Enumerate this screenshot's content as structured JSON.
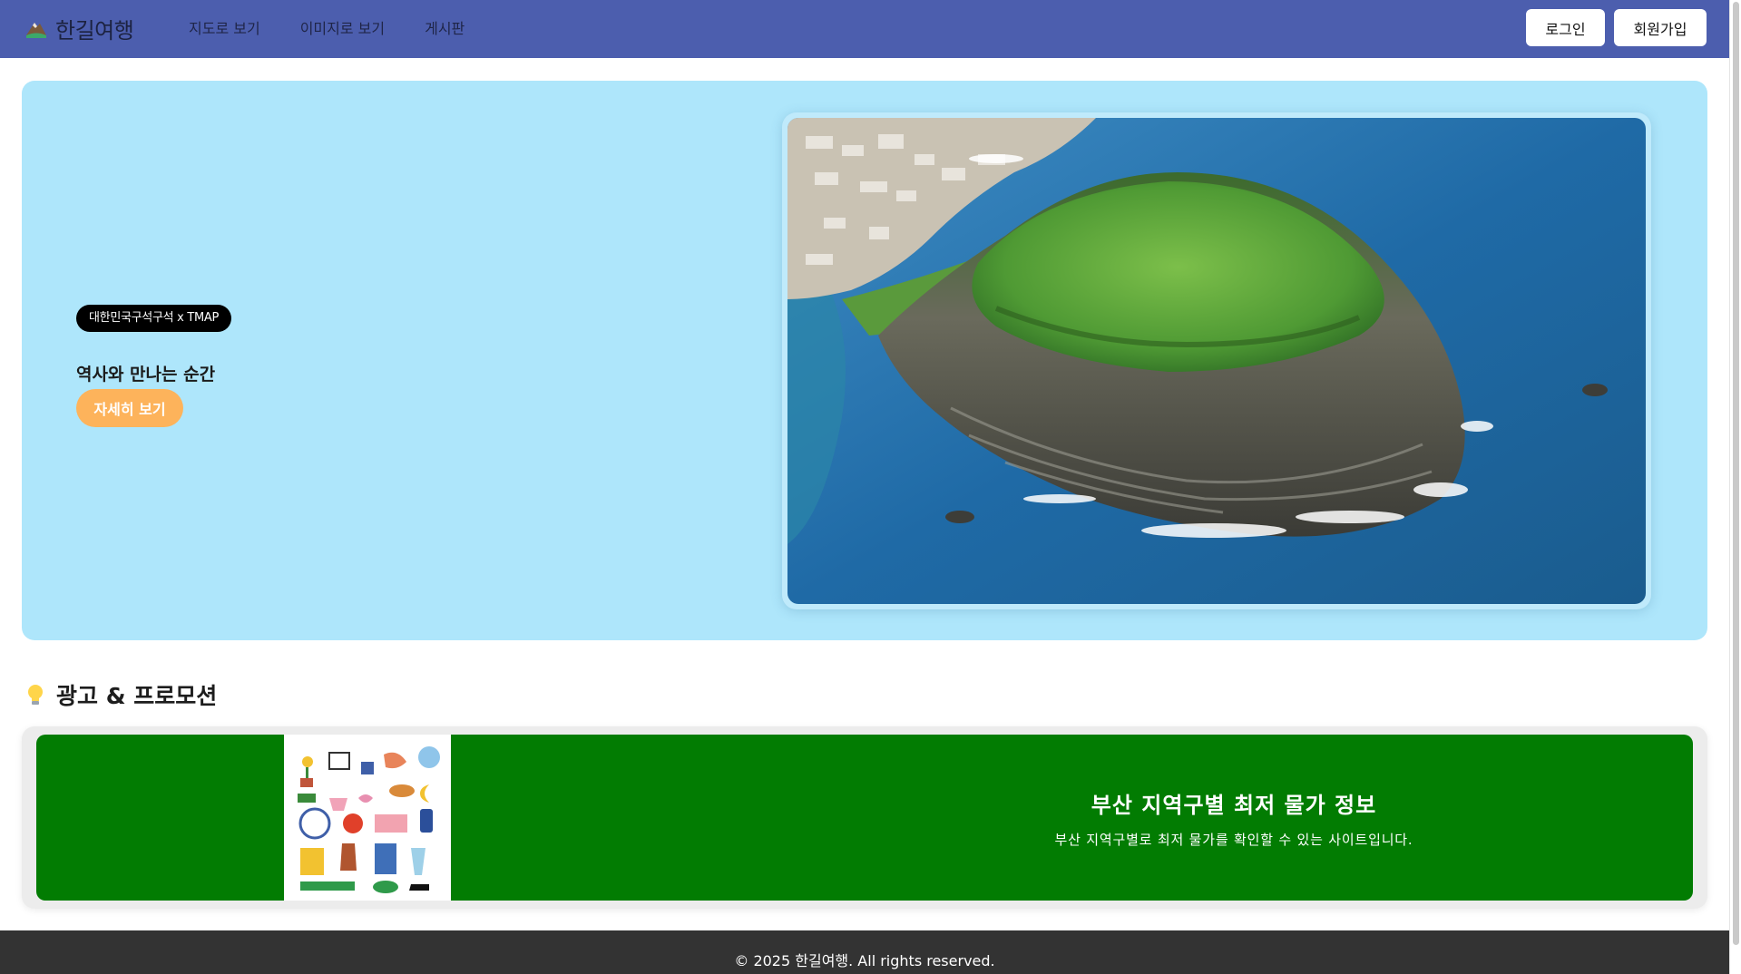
{
  "header": {
    "logo_text": "한길여행",
    "nav": [
      "지도로 보기",
      "이미지로 보기",
      "게시판"
    ],
    "login_label": "로그인",
    "signup_label": "회원가입",
    "bg_color": "#4c5eae"
  },
  "hero": {
    "badge": "대한민국구석구석 x TMAP",
    "title": "역사와 만나는 순간",
    "cta_label": "자세히 보기",
    "bg_color": "#aee6fb",
    "cta_color": "#fdb35b"
  },
  "promo": {
    "section_icon": "lightbulb-icon",
    "section_title": "광고 & 프로모션",
    "banner_title": "부산 지역구별 최저 물가 정보",
    "banner_desc": "부산 지역구별로 최저 물가를 확인할 수 있는 사이트입니다.",
    "banner_color": "#027c02"
  },
  "footer": {
    "copyright": "© 2025 한길여행. All rights reserved."
  }
}
